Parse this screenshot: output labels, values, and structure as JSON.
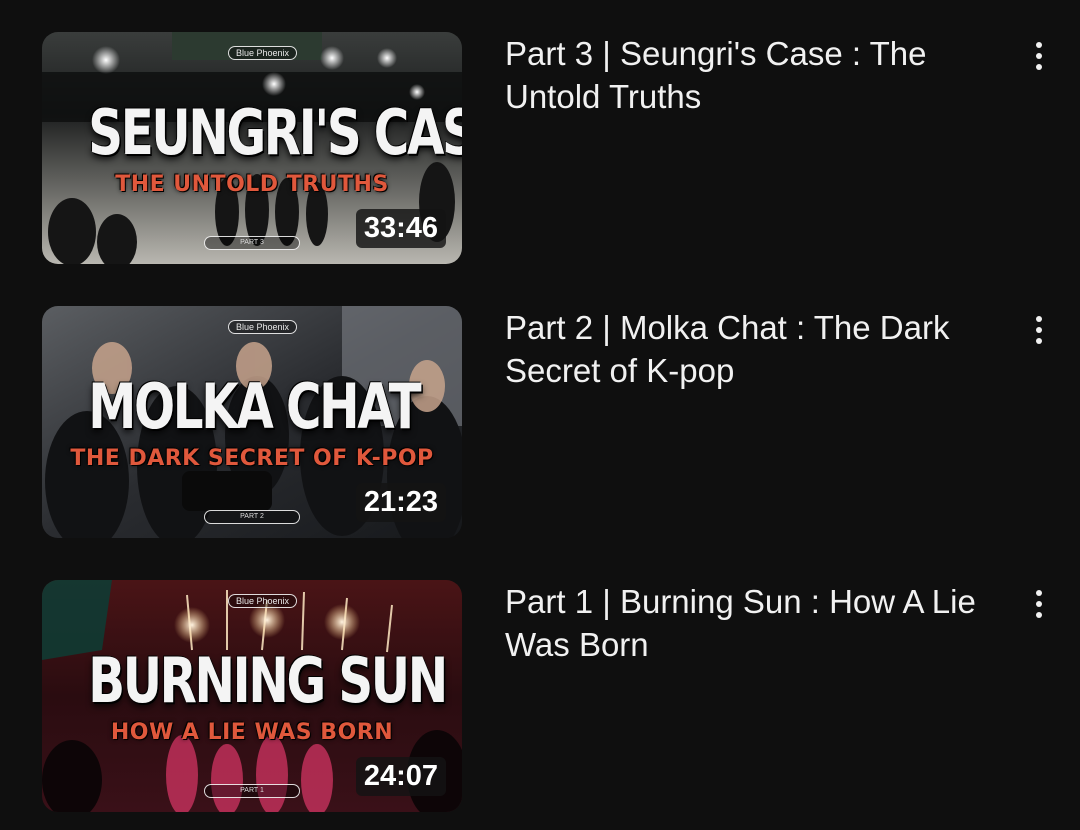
{
  "colors": {
    "background": "#0f0f0f",
    "text_primary": "#f1f1f1",
    "subtitle_accent": "#e0583c",
    "duration_bg": "#141414"
  },
  "videos": [
    {
      "title": "Part 3 | Seungri's Case : The Untold Truths",
      "duration": "33:46",
      "thumbnail": {
        "channel_badge": "Blue Phoenix",
        "headline": "SEUNGRI'S CASE",
        "subline": "THE UNTOLD TRUTHS",
        "part_label": "PART 3"
      },
      "menu_icon": "more-vert-icon"
    },
    {
      "title": "Part 2 | Molka Chat : The Dark Secret of K-pop",
      "duration": "21:23",
      "thumbnail": {
        "channel_badge": "Blue Phoenix",
        "headline": "MOLKA CHAT",
        "subline": "THE DARK SECRET OF K-POP",
        "part_label": "PART 2"
      },
      "menu_icon": "more-vert-icon"
    },
    {
      "title": "Part 1 | Burning Sun : How A Lie Was Born",
      "duration": "24:07",
      "thumbnail": {
        "channel_badge": "Blue Phoenix",
        "headline": "BURNING SUN",
        "subline": "HOW A LIE WAS BORN",
        "part_label": "PART 1"
      },
      "menu_icon": "more-vert-icon"
    }
  ]
}
